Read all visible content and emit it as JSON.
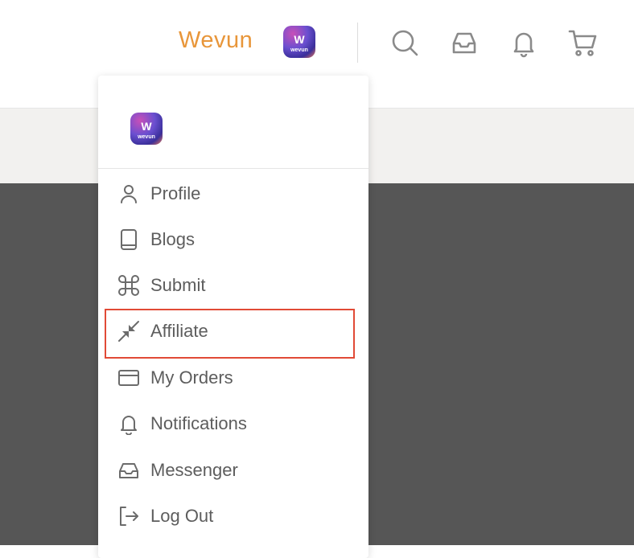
{
  "header": {
    "username": "Wevun",
    "avatar_text": "W",
    "avatar_caption": "wevun",
    "icons": [
      "search-icon",
      "inbox-icon",
      "bell-icon",
      "cart-icon"
    ]
  },
  "dropdown": {
    "avatar_text": "W",
    "avatar_caption": "wevun",
    "items": [
      {
        "label": "Profile",
        "icon": "user-icon"
      },
      {
        "label": "Blogs",
        "icon": "tablet-icon"
      },
      {
        "label": "Submit",
        "icon": "command-icon"
      },
      {
        "label": "Affiliate",
        "icon": "compress-arrows-icon"
      },
      {
        "label": "My Orders",
        "icon": "credit-card-icon"
      },
      {
        "label": "Notifications",
        "icon": "bell-icon"
      },
      {
        "label": "Messenger",
        "icon": "inbox-icon"
      },
      {
        "label": "Log Out",
        "icon": "logout-icon"
      }
    ]
  },
  "colors": {
    "accent": "#e8963a",
    "highlight": "#e14a36",
    "dark_panel": "#565656",
    "band": "#f2f1ef"
  }
}
